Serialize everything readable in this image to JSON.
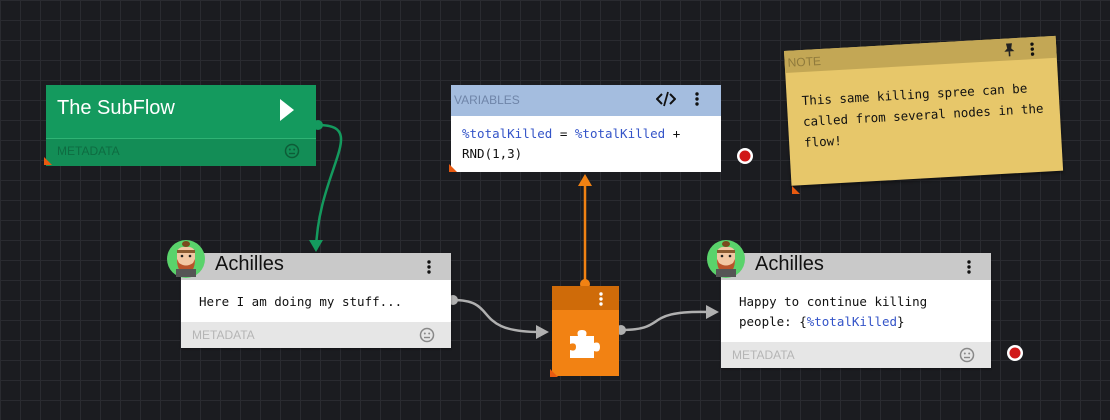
{
  "subflow": {
    "title": "The SubFlow",
    "meta_label": "METADATA"
  },
  "character_left": {
    "name": "Achilles",
    "text": "Here I am doing my stuff...",
    "meta_label": "METADATA"
  },
  "character_right": {
    "name": "Achilles",
    "text_prefix": "Happy to continue killing",
    "text_line2_prefix": "people: {",
    "text_var": "%totalKilled",
    "text_suffix": "}",
    "meta_label": "METADATA"
  },
  "variables": {
    "label": "VARIABLES",
    "var1": "%totalKilled",
    "op": " = ",
    "var2": "%totalKilled",
    "plus": " +",
    "line2": "RND(1,3)"
  },
  "note": {
    "label": "NOTE",
    "text": "This same killing spree can be called from several nodes in the flow!"
  },
  "colors": {
    "subflow": "#149a5e",
    "variables_header": "#a4bddf",
    "note": "#e7c76a",
    "puzzle": "#f28213",
    "connector_green": "#149a5e",
    "connector_orange": "#f28213",
    "connector_gray": "#b0b0b0"
  }
}
